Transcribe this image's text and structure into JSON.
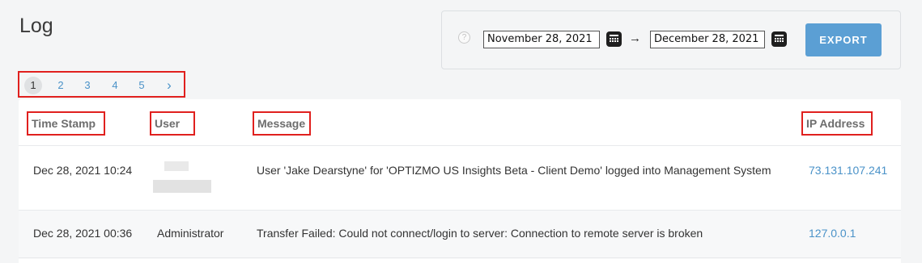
{
  "page": {
    "title": "Log"
  },
  "filters": {
    "help_icon": "?",
    "start_date": "November 28, 2021",
    "end_date": "December 28, 2021",
    "arrow": "→",
    "export_label": "EXPORT"
  },
  "pagination": {
    "pages": [
      "1",
      "2",
      "3",
      "4",
      "5"
    ],
    "current": "1",
    "next": "›"
  },
  "table": {
    "headers": {
      "timestamp": "Time Stamp",
      "user": "User",
      "message": "Message",
      "ip": "IP Address"
    },
    "rows": [
      {
        "timestamp": "Dec 28, 2021 10:24",
        "user": "",
        "message": "User 'Jake Dearstyne' for 'OPTIZMO US Insights Beta - Client Demo' logged into Management System",
        "ip": "73.131.107.241"
      },
      {
        "timestamp": "Dec 28, 2021 00:36",
        "user": "Administrator",
        "message": "Transfer Failed: Could not connect/login to server: Connection to remote server is broken",
        "ip": "127.0.0.1"
      }
    ]
  },
  "colors": {
    "accent": "#5b9fd4",
    "link": "#4a92c8",
    "highlight": "#e0201e"
  }
}
